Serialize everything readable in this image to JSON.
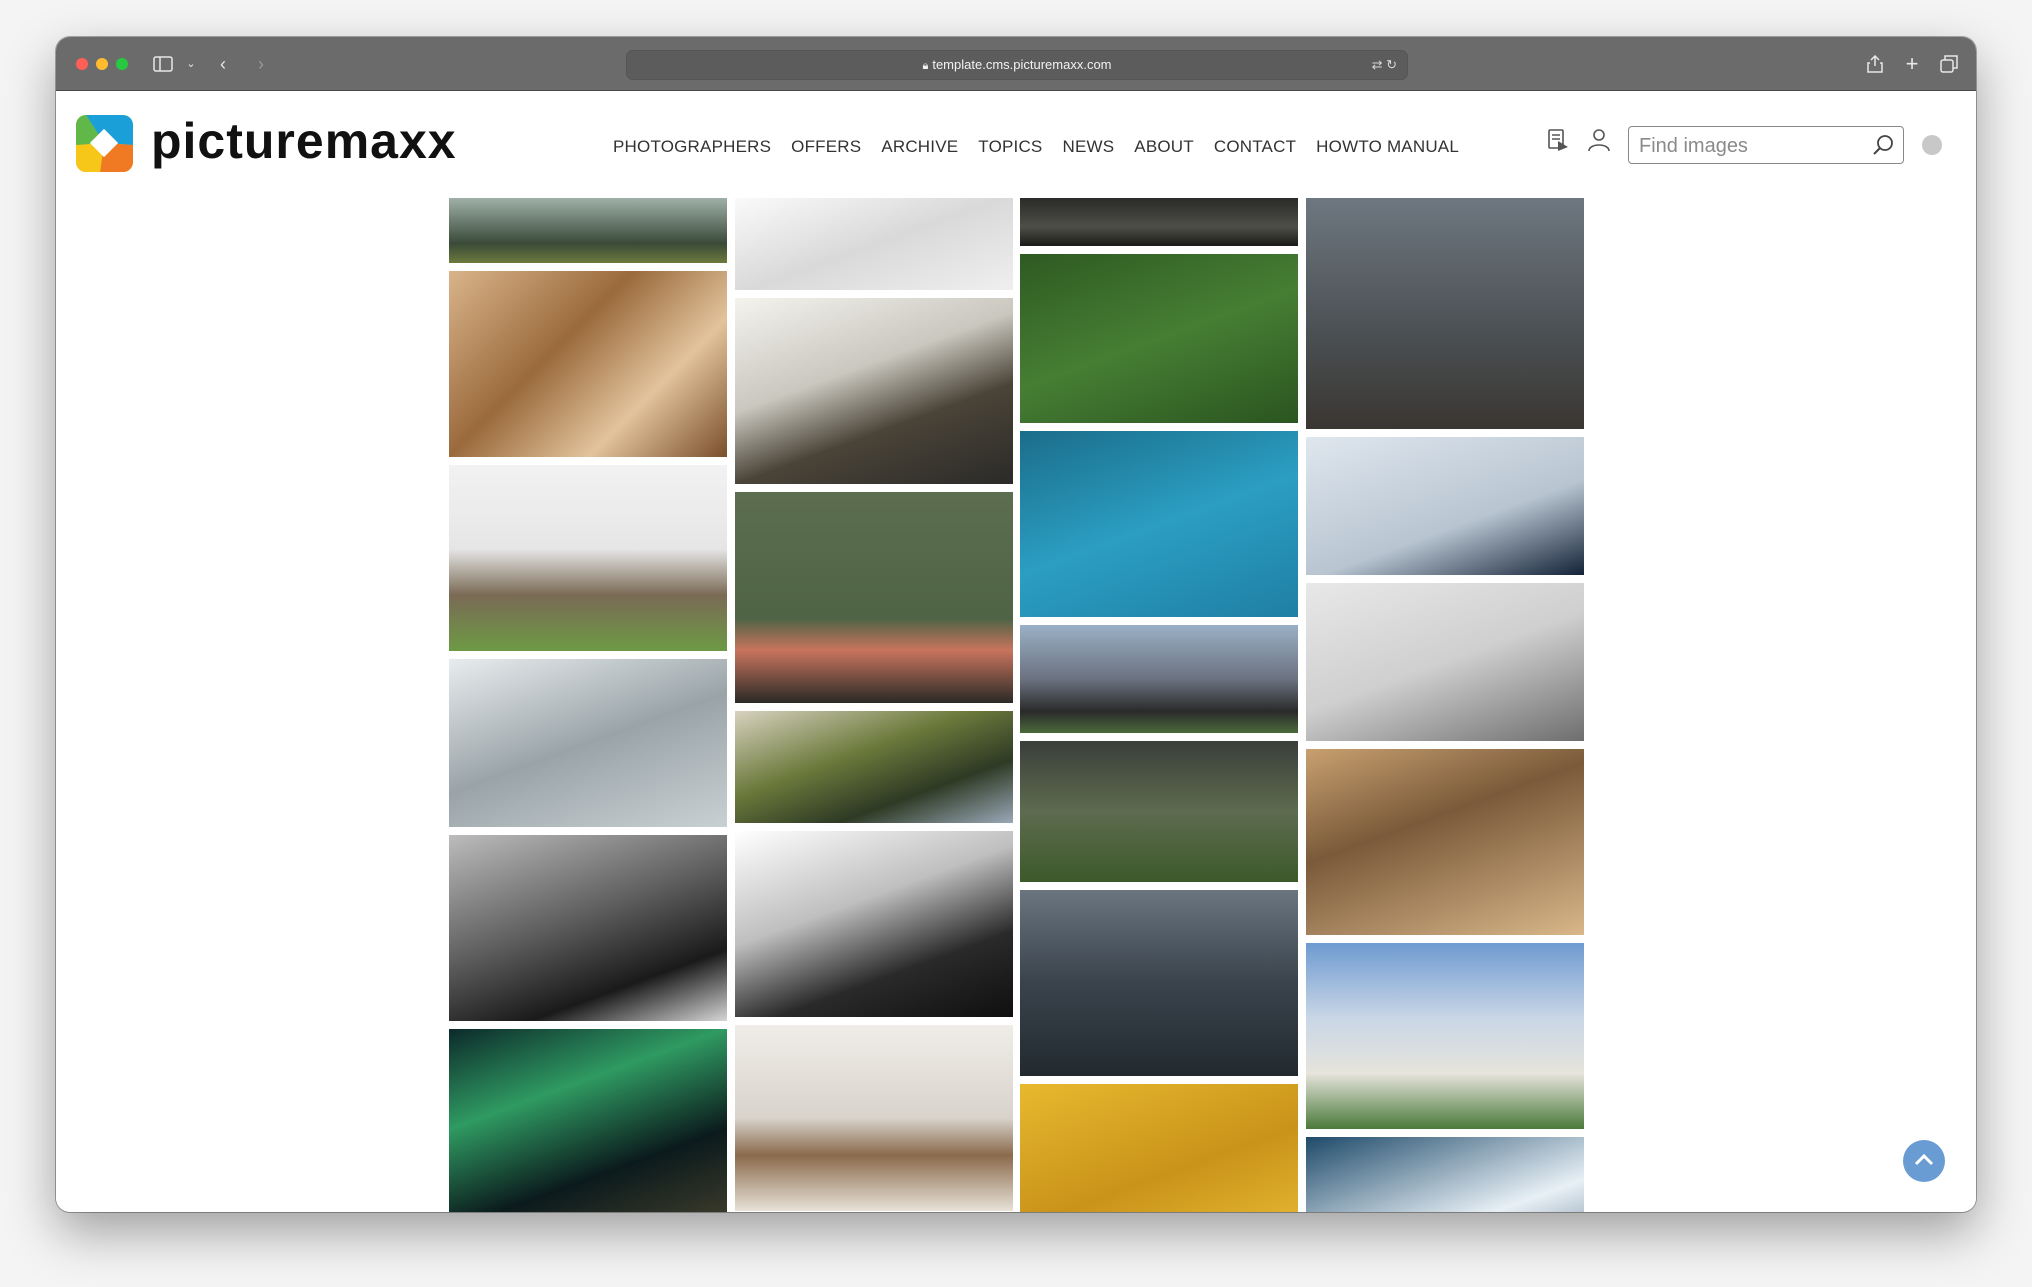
{
  "browser": {
    "url": "template.cms.picturemaxx.com",
    "traffic_lights": [
      "#fe5f57",
      "#febc2e",
      "#28c840"
    ]
  },
  "site": {
    "logo_text": "picturemaxx",
    "nav": [
      "PHOTOGRAPHERS",
      "OFFERS",
      "ARCHIVE",
      "TOPICS",
      "NEWS",
      "ABOUT",
      "CONTACT",
      "HOWTO MANUAL"
    ],
    "search_placeholder": "Find images",
    "accent_color": "#6a9cd4"
  },
  "gallery": {
    "columns": [
      [
        "lake reflection",
        "wooden ceiling",
        "glass house terrace",
        "curved concrete interior",
        "basalt columns beach",
        "aurora borealis"
      ],
      [
        "light shadows",
        "mountain road",
        "pink sofa room",
        "mountain valley aerial",
        "curved architecture",
        "living room"
      ],
      [
        "dark hills",
        "rugby field aerial",
        "swimmers aerial",
        "modern house",
        "green mountain",
        "fjord lake",
        "yellow stadium seats"
      ],
      [
        "mountain goats",
        "climber snowy peaks",
        "office interior",
        "basketball players",
        "modern building",
        "ocean wave"
      ]
    ]
  }
}
